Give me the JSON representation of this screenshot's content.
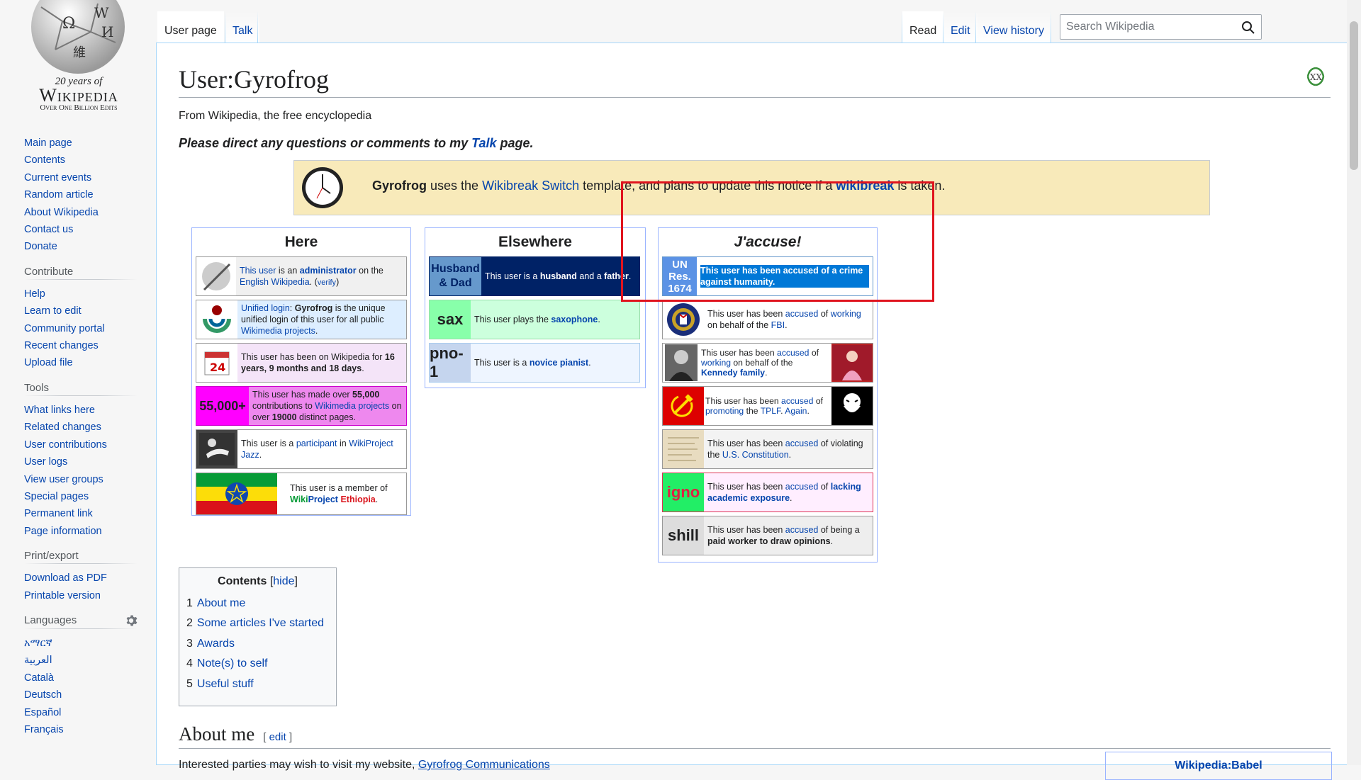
{
  "logo": {
    "wordmark": "Wikipedia",
    "anniversary": "20 years of",
    "edits": "Over One Billion Edits"
  },
  "sidebar": {
    "navigation": [
      "Main page",
      "Contents",
      "Current events",
      "Random article",
      "About Wikipedia",
      "Contact us",
      "Donate"
    ],
    "contribute_title": "Contribute",
    "contribute": [
      "Help",
      "Learn to edit",
      "Community portal",
      "Recent changes",
      "Upload file"
    ],
    "tools_title": "Tools",
    "tools": [
      "What links here",
      "Related changes",
      "User contributions",
      "User logs",
      "View user groups",
      "Special pages",
      "Permanent link",
      "Page information"
    ],
    "print_title": "Print/export",
    "print": [
      "Download as PDF",
      "Printable version"
    ],
    "languages_title": "Languages",
    "languages": [
      "አማርኛ",
      "العربية",
      "Català",
      "Deutsch",
      "Español",
      "Français"
    ]
  },
  "tabs": {
    "user_page": "User page",
    "talk": "Talk",
    "read": "Read",
    "edit": "Edit",
    "view_history": "View history"
  },
  "search": {
    "placeholder": "Search Wikipedia"
  },
  "page": {
    "title": "User:Gyrofrog",
    "tagline": "From Wikipedia, the free encyclopedia",
    "direct_pre": "Please direct any questions or comments to my ",
    "direct_link": "Talk",
    "direct_post": " page.",
    "notice": {
      "user": "Gyrofrog",
      "t1": " uses the ",
      "link1": "Wikibreak Switch",
      "t2": " template, and plans to update this notice if a ",
      "link2": "wikibreak",
      "t3": " is taken."
    }
  },
  "here": {
    "title": "Here",
    "admin": {
      "p1": "This user",
      "p2": " is an ",
      "p3": "administrator",
      "p4": " on the ",
      "p5": "English Wikipedia",
      "p6": ". (",
      "p7": "verify",
      "p8": ")"
    },
    "sul": {
      "p1": "Unified login",
      "p2": ": ",
      "p3": "Gyrofrog",
      "p4": " is the unique unified login of this user for all public ",
      "p5": "Wikimedia projects",
      "p6": "."
    },
    "tenure": {
      "date": "24",
      "p1": "This user has been on Wikipedia for ",
      "p2": "16 years, 9 months and 18 days",
      "p3": "."
    },
    "edits": {
      "badge": "55,000+",
      "p1": "This user has made over ",
      "p2": "55,000",
      "p3": " contributions to ",
      "p4": "Wikimedia projects",
      "p5": " on over ",
      "p6": "19000",
      "p7": " distinct pages."
    },
    "jazz": {
      "p1": "This user is a ",
      "p2": "participant",
      "p3": " in ",
      "p4": "WikiProject Jazz",
      "p5": "."
    },
    "ethiopia": {
      "p1": "This user is a member of ",
      "p2": "Wiki",
      "p3": "Project",
      "p4": " Ethiopia",
      "p5": "."
    }
  },
  "elsewhere": {
    "title": "Elsewhere",
    "husband": {
      "label": "Husband & Dad",
      "p1": "This user is a ",
      "p2": "husband",
      "p3": " and a ",
      "p4": "father",
      "p5": "."
    },
    "sax": {
      "label": "sax",
      "p1": "This user plays the ",
      "p2": "saxophone",
      "p3": "."
    },
    "piano": {
      "label": "pno-1",
      "p1": "This user is a ",
      "p2": "novice pianist",
      "p3": "."
    }
  },
  "jaccuse": {
    "title": "J'accuse!",
    "un": {
      "label": "UN Res. 1674",
      "text": "This user has been accused of a crime against humanity."
    },
    "fbi": {
      "p1": "This user has been ",
      "p2": "accused",
      "p3": " of ",
      "p4": "working",
      "p5": " on behalf of the ",
      "p6": "FBI",
      "p7": "."
    },
    "kennedy": {
      "p1": "This user has been ",
      "p2": "accused",
      "p3": " of ",
      "p4": "working",
      "p5": " on behalf of the ",
      "p6": "Kennedy family",
      "p7": "."
    },
    "tplf": {
      "p1": "This user has been ",
      "p2": "accused",
      "p3": " of ",
      "p4": "promoting",
      "p5": " the ",
      "p6": "TPLF",
      "p7": ". ",
      "p8": "Again",
      "p9": "."
    },
    "const": {
      "p1": "This user has been ",
      "p2": "accused",
      "p3": " of violating the ",
      "p4": "U.S. Constitution",
      "p5": "."
    },
    "igno": {
      "label": "igno",
      "p1": "This user has been ",
      "p2": "accused",
      "p3": " of ",
      "p4": "lacking academic exposure",
      "p5": "."
    },
    "shill": {
      "label": "shill",
      "p1": "This user has been ",
      "p2": "accused",
      "p3": " of being a ",
      "p4": "paid worker to draw opinions",
      "p5": "."
    }
  },
  "toc": {
    "title": "Contents",
    "hide": "hide",
    "items": [
      {
        "num": "1",
        "label": "About me"
      },
      {
        "num": "2",
        "label": "Some articles I've started"
      },
      {
        "num": "3",
        "label": "Awards"
      },
      {
        "num": "4",
        "label": "Note(s) to self"
      },
      {
        "num": "5",
        "label": "Useful stuff"
      }
    ]
  },
  "about": {
    "heading": "About me",
    "edit": "edit",
    "text": "Interested parties may wish to visit my website, ",
    "link": "Gyrofrog Communications",
    "babel": "Wikipedia:Babel"
  },
  "colors": {
    "link": "#0645ad",
    "notice_bg": "#f8eaba",
    "highlight": "#e0141e",
    "selection": "#0078d7"
  }
}
